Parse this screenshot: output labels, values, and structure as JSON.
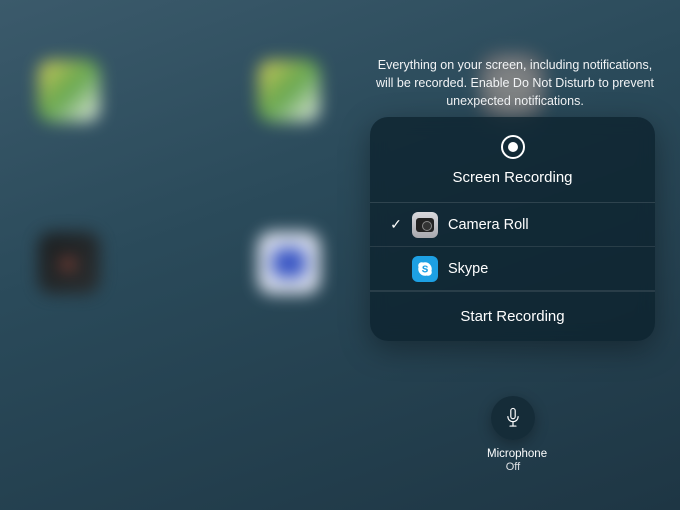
{
  "info_text": "Everything on your screen, including notifications, will be recorded. Enable Do Not Disturb to prevent unexpected notifications.",
  "panel": {
    "title": "Screen Recording",
    "destinations": [
      {
        "label": "Camera Roll",
        "icon": "camera-icon",
        "selected": true
      },
      {
        "label": "Skype",
        "icon": "skype-icon",
        "selected": false
      }
    ],
    "start_label": "Start Recording"
  },
  "microphone": {
    "label": "Microphone",
    "state": "Off"
  }
}
